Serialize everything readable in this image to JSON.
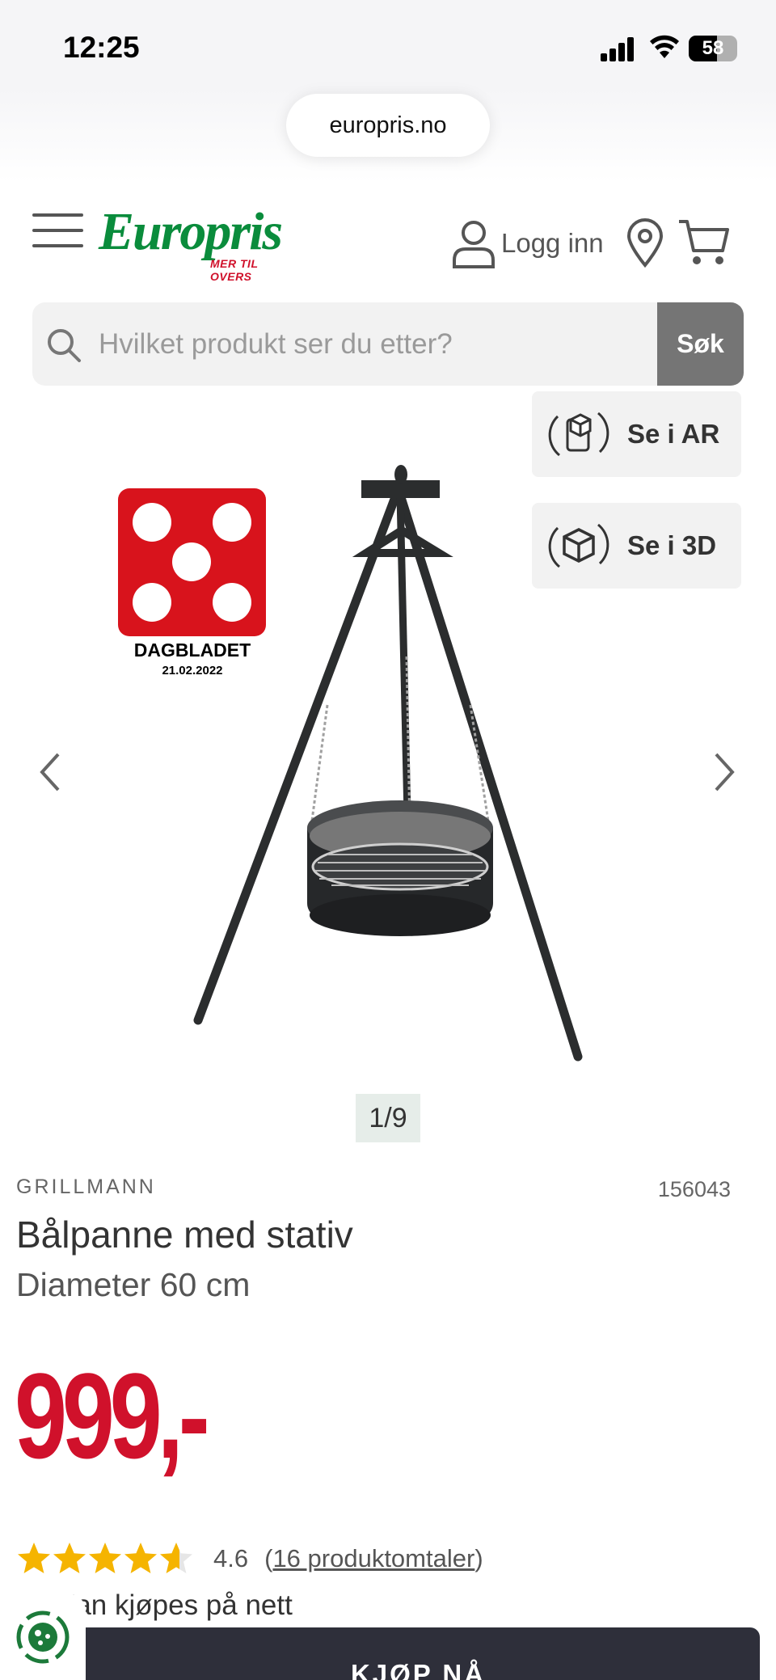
{
  "status_bar": {
    "time": "12:25",
    "battery": "58",
    "battery_level": 0.58
  },
  "browser": {
    "url": "europris.no"
  },
  "header": {
    "logo_text": "Europris",
    "logo_tagline": "MER TIL OVERS",
    "login_label": "Logg inn"
  },
  "search": {
    "placeholder": "Hvilket produkt ser du etter?",
    "button_label": "Søk"
  },
  "gallery": {
    "ar_label": "Se i AR",
    "view3d_label": "Se i 3D",
    "counter": "1/9",
    "badge": {
      "title": "DAGBLADET",
      "date": "21.02.2022",
      "dice_value": 5
    }
  },
  "product": {
    "brand": "GRILLMANN",
    "sku": "156043",
    "title": "Bålpanne med stativ",
    "subtitle": "Diameter 60 cm",
    "price": "999,-",
    "rating_value": "4.6",
    "rating_stars": 4.6,
    "review_prefix": "(",
    "review_link": "16 produktomtaler",
    "review_suffix": ")",
    "availability": "Kan kjøpes på nett",
    "buy_label": "KJØP NÅ"
  },
  "colors": {
    "brand_green": "#0a8c3c",
    "brand_red": "#d0112b",
    "star": "#f5b400",
    "buy_button": "#2e2f3a"
  }
}
